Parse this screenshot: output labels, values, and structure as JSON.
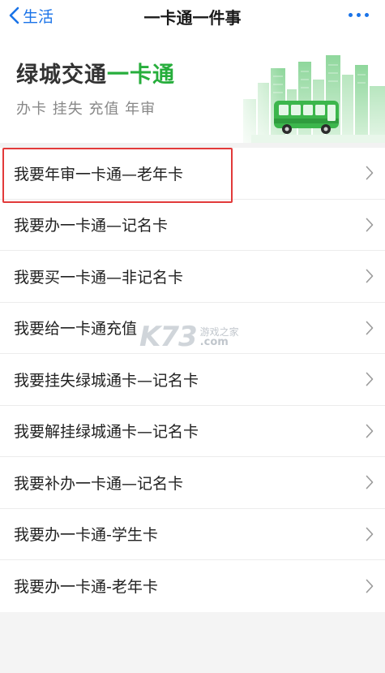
{
  "nav": {
    "back_label": "生活",
    "title": "一卡通一件事"
  },
  "banner": {
    "title_main": "绿城交通",
    "title_accent": "一卡通",
    "subtitle": "办卡 挂失 充值 年审"
  },
  "menu": {
    "items": [
      {
        "label": "我要年审一卡通—老年卡"
      },
      {
        "label": "我要办一卡通—记名卡"
      },
      {
        "label": "我要买一卡通—非记名卡"
      },
      {
        "label": "我要给一卡通充值"
      },
      {
        "label": "我要挂失绿城通卡—记名卡"
      },
      {
        "label": "我要解挂绿城通卡—记名卡"
      },
      {
        "label": "我要补办一卡通—记名卡"
      },
      {
        "label": "我要办一卡通-学生卡"
      },
      {
        "label": "我要办一卡通-老年卡"
      }
    ]
  },
  "watermark": {
    "logo": "K73",
    "line1": "游戏之家",
    "line2": ".com"
  },
  "colors": {
    "accent_blue": "#1a73e8",
    "accent_green": "#27ae3c",
    "highlight_red": "#e23a3a"
  }
}
